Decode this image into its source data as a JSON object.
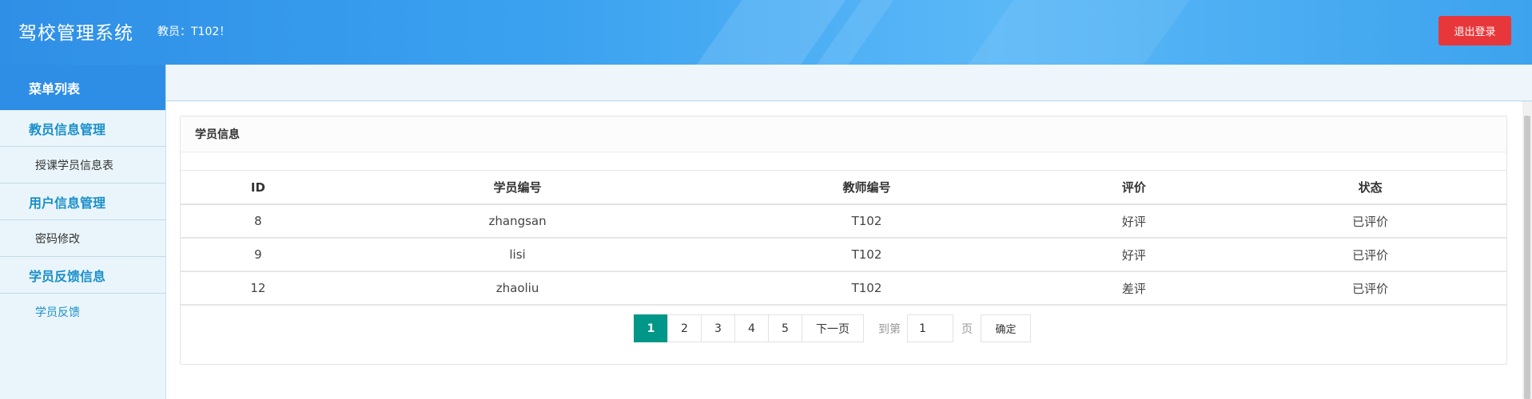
{
  "header": {
    "title": "驾校管理系统",
    "welcome": "教员：T102！",
    "logout_label": "退出登录"
  },
  "sidebar": {
    "heading": "菜单列表",
    "groups": [
      {
        "label": "教员信息管理",
        "items": [
          {
            "label": "授课学员信息表"
          }
        ]
      },
      {
        "label": "用户信息管理",
        "items": [
          {
            "label": "密码修改"
          }
        ]
      },
      {
        "label": "学员反馈信息",
        "items": [
          {
            "label": "学员反馈"
          }
        ]
      }
    ]
  },
  "card": {
    "title": "学员信息",
    "columns": [
      "ID",
      "学员编号",
      "教师编号",
      "评价",
      "状态"
    ],
    "rows": [
      [
        "8",
        "zhangsan",
        "T102",
        "好评",
        "已评价"
      ],
      [
        "9",
        "lisi",
        "T102",
        "好评",
        "已评价"
      ],
      [
        "12",
        "zhaoliu",
        "T102",
        "差评",
        "已评价"
      ]
    ]
  },
  "pager": {
    "pages": [
      "1",
      "2",
      "3",
      "4",
      "5"
    ],
    "current": "1",
    "next_label": "下一页",
    "goto_label": "到第",
    "page_input_value": "1",
    "page_unit": "页",
    "confirm_label": "确定"
  },
  "colors": {
    "header_accent": "#2f8fe6",
    "logout": "#e8373b",
    "sidebar_link": "#1a8fc9",
    "pager_current": "#009688"
  }
}
